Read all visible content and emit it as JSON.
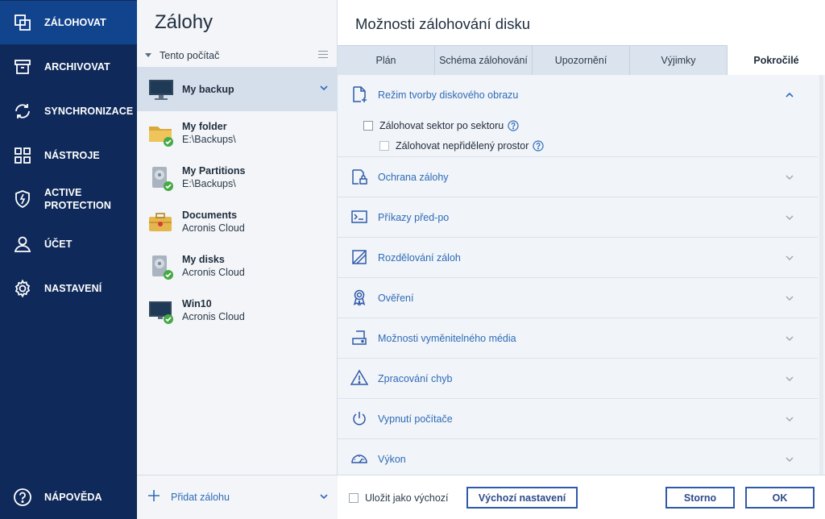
{
  "colors": {
    "nav_bg": "#0f2a5a",
    "nav_active": "#12448e",
    "accent": "#2e6bb8",
    "ok_green": "#45a945"
  },
  "nav": {
    "items": [
      {
        "label": "ZÁLOHOVAT",
        "icon": "copy-icon"
      },
      {
        "label": "ARCHIVOVAT",
        "icon": "archive-box-icon"
      },
      {
        "label": "SYNCHRONIZACE",
        "icon": "sync-icon"
      },
      {
        "label": "NÁSTROJE",
        "icon": "grid-tools-icon"
      },
      {
        "label": "ACTIVE\nPROTECTION",
        "icon": "shield-bolt-icon"
      },
      {
        "label": "ÚČET",
        "icon": "user-icon"
      },
      {
        "label": "NASTAVENÍ",
        "icon": "gear-icon"
      }
    ],
    "help": {
      "label": "NÁPOVĚDA",
      "icon": "help-circle-icon"
    }
  },
  "backups": {
    "title": "Zálohy",
    "group_label": "Tento počítač",
    "items": [
      {
        "name": "My backup",
        "sub": "",
        "icon": "monitor-icon"
      },
      {
        "name": "My folder",
        "sub": "E:\\Backups\\",
        "icon": "folder-icon"
      },
      {
        "name": "My Partitions",
        "sub": "E:\\Backups\\",
        "icon": "disk-icon"
      },
      {
        "name": "Documents",
        "sub": "Acronis Cloud",
        "icon": "briefcase-icon"
      },
      {
        "name": "My disks",
        "sub": "Acronis Cloud",
        "icon": "disk-icon"
      },
      {
        "name": "Win10",
        "sub": "Acronis Cloud",
        "icon": "monitor-icon"
      }
    ],
    "add_label": "Přidat zálohu"
  },
  "options": {
    "title": "Možnosti zálohování disku",
    "tabs": [
      "Plán",
      "Schéma zálohování",
      "Upozornění",
      "Výjimky",
      "Pokročilé"
    ],
    "active_tab": "Pokročilé",
    "sections": [
      {
        "label": "Režim tvorby diskového obrazu",
        "icon": "file-plus-icon"
      },
      {
        "label": "Ochrana zálohy",
        "icon": "lock-file-icon"
      },
      {
        "label": "Příkazy před-po",
        "icon": "terminal-icon"
      },
      {
        "label": "Rozdělování záloh",
        "icon": "split-icon"
      },
      {
        "label": "Ověření",
        "icon": "badge-icon"
      },
      {
        "label": "Možnosti vyměnitelného média",
        "icon": "removable-media-icon"
      },
      {
        "label": "Zpracování chyb",
        "icon": "warning-icon"
      },
      {
        "label": "Vypnutí počítače",
        "icon": "power-icon"
      },
      {
        "label": "Výkon",
        "icon": "speedometer-icon"
      }
    ],
    "image_mode": {
      "sector_by_sector": "Zálohovat sektor po sektoru",
      "unallocated": "Zálohovat nepřidělený prostor"
    },
    "footer": {
      "save_default": "Uložit jako výchozí",
      "reset_button": "Výchozí nastavení",
      "cancel_button": "Storno",
      "ok_button": "OK"
    }
  }
}
